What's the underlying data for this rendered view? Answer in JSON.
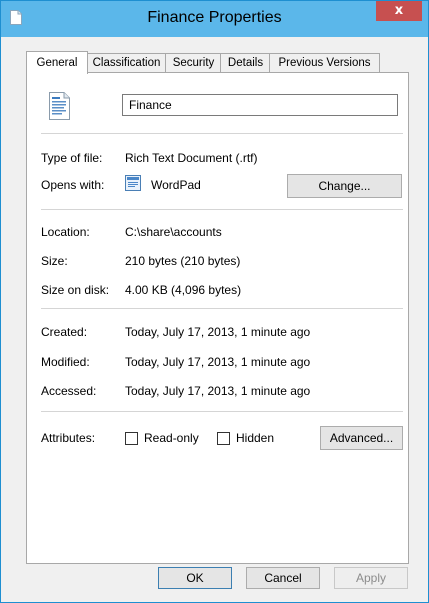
{
  "window": {
    "title": "Finance Properties",
    "close_glyph": "x"
  },
  "tabs": [
    {
      "label": "General",
      "active": true
    },
    {
      "label": "Classification",
      "active": false
    },
    {
      "label": "Security",
      "active": false
    },
    {
      "label": "Details",
      "active": false
    },
    {
      "label": "Previous Versions",
      "active": false
    }
  ],
  "general": {
    "file_name": "Finance",
    "type_label": "Type of file:",
    "type_value": "Rich Text Document (.rtf)",
    "opens_label": "Opens with:",
    "opens_value": "WordPad",
    "change_button": "Change...",
    "location_label": "Location:",
    "location_value": "C:\\share\\accounts",
    "size_label": "Size:",
    "size_value": "210 bytes (210 bytes)",
    "disk_label": "Size on disk:",
    "disk_value": "4.00 KB (4,096 bytes)",
    "created_label": "Created:",
    "created_value": "Today, July 17, 2013, 1 minute ago",
    "modified_label": "Modified:",
    "modified_value": "Today, July 17, 2013, 1 minute ago",
    "accessed_label": "Accessed:",
    "accessed_value": "Today, July 17, 2013, 1 minute ago",
    "attributes_label": "Attributes:",
    "readonly_label": "Read-only",
    "readonly_checked": false,
    "hidden_label": "Hidden",
    "hidden_checked": false,
    "advanced_button": "Advanced..."
  },
  "footer": {
    "ok": "OK",
    "cancel": "Cancel",
    "apply": "Apply"
  },
  "icons": {
    "title": "document-icon",
    "file": "rtf-document-icon",
    "app": "wordpad-icon"
  },
  "colors": {
    "titlebar": "#5bb7ea",
    "close": "#c75050",
    "border": "#1e8fd1"
  }
}
